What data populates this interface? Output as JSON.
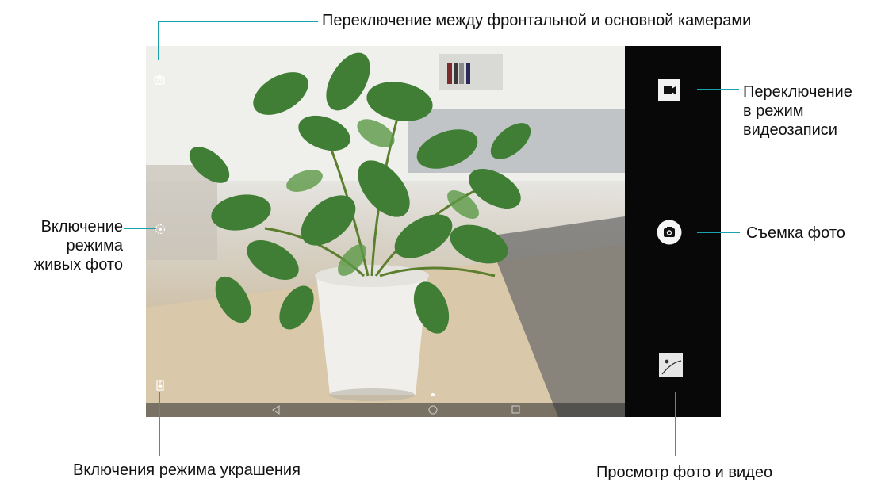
{
  "callouts": {
    "switch_camera": "Переключение между фронтальной и основной камерами",
    "video_mode_1": "Переключение",
    "video_mode_2": "в режим",
    "video_mode_3": "видеозаписи",
    "take_photo": "Съемка фото",
    "live_photo_1": "Включение",
    "live_photo_2": "режима",
    "live_photo_3": "живых фото",
    "beauty_mode": "Включения режима украшения",
    "gallery": "Просмотр фото и видео"
  },
  "icons": {
    "switch_camera": "camera-switch-icon",
    "live_photo": "live-photo-icon",
    "beauty": "beauty-mode-icon",
    "video": "video-camera-icon",
    "shutter": "camera-icon",
    "gallery": "gallery-thumbnail-icon"
  },
  "colors": {
    "callout_line": "#1aa3ad",
    "control_panel": "#080808"
  }
}
